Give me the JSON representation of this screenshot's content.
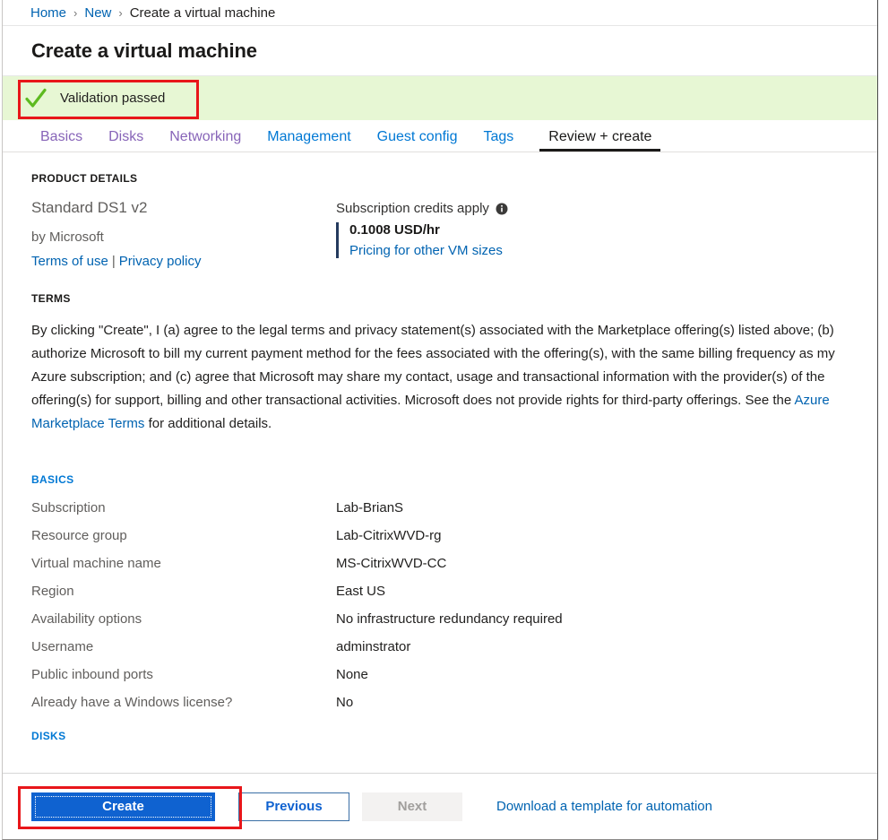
{
  "breadcrumb": {
    "items": [
      {
        "label": "Home",
        "link": true
      },
      {
        "label": "New",
        "link": true
      },
      {
        "label": "Create a virtual machine",
        "link": false
      }
    ],
    "separator": "›"
  },
  "header": {
    "title": "Create a virtual machine"
  },
  "banner": {
    "status_text": "Validation passed",
    "icon": "green-checkmark-icon",
    "background_color": "#e7f7d4",
    "check_color": "#5dba1f",
    "highlight_color": "#e8161a"
  },
  "tabs": [
    {
      "label": "Basics",
      "state": "visited"
    },
    {
      "label": "Disks",
      "state": "visited"
    },
    {
      "label": "Networking",
      "state": "visited"
    },
    {
      "label": "Management",
      "state": "link"
    },
    {
      "label": "Guest config",
      "state": "link"
    },
    {
      "label": "Tags",
      "state": "link"
    },
    {
      "label": "Review + create",
      "state": "active"
    }
  ],
  "product_details": {
    "heading": "PRODUCT DETAILS",
    "name": "Standard DS1 v2",
    "publisher": "by Microsoft",
    "terms_of_use_label": "Terms of use",
    "separator": "|",
    "privacy_policy_label": "Privacy policy",
    "credits_label": "Subscription credits apply",
    "info_icon": "info-icon",
    "price": "0.1008 USD/hr",
    "pricing_link_label": "Pricing for other VM sizes",
    "accent_bar_color": "#243a5e"
  },
  "terms": {
    "heading": "TERMS",
    "body_before_link": "By clicking \"Create\", I (a) agree to the legal terms and privacy statement(s) associated with the Marketplace offering(s) listed above; (b) authorize Microsoft to bill my current payment method for the fees associated with the offering(s), with the same billing frequency as my Azure subscription; and (c) agree that Microsoft may share my contact, usage and transactional information with the provider(s) of the offering(s) for support, billing and other transactional activities. Microsoft does not provide rights for third-party offerings. See the ",
    "link_label": "Azure Marketplace Terms",
    "body_after_link": " for additional details."
  },
  "basics": {
    "heading": "BASICS",
    "rows": [
      {
        "key": "Subscription",
        "value": "Lab-BrianS"
      },
      {
        "key": "Resource group",
        "value": "Lab-CitrixWVD-rg"
      },
      {
        "key": "Virtual machine name",
        "value": "MS-CitrixWVD-CC"
      },
      {
        "key": "Region",
        "value": "East US"
      },
      {
        "key": "Availability options",
        "value": "No infrastructure redundancy required"
      },
      {
        "key": "Username",
        "value": "adminstrator"
      },
      {
        "key": "Public inbound ports",
        "value": "None"
      },
      {
        "key": "Already have a Windows license?",
        "value": "No"
      }
    ]
  },
  "disks": {
    "heading": "DISKS"
  },
  "footer": {
    "create_label": "Create",
    "previous_label": "Previous",
    "next_label": "Next",
    "next_disabled": true,
    "download_template_label": "Download a template for automation",
    "primary_color": "#0f62d0",
    "highlight_color": "#e8161a"
  }
}
